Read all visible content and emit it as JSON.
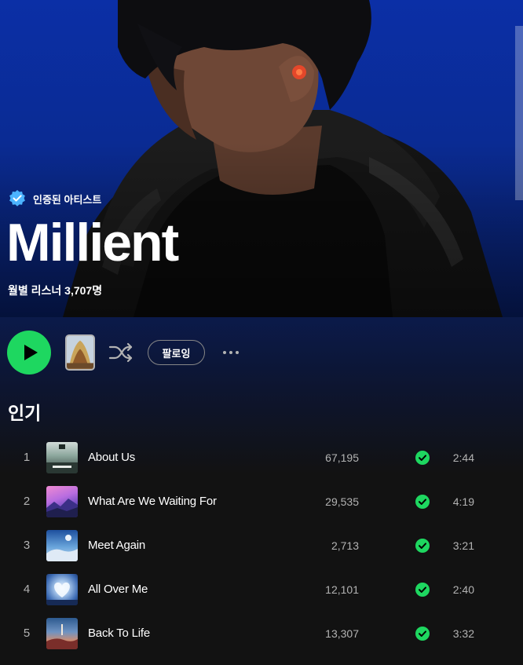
{
  "artist": {
    "verified_label": "인증된 아티스트",
    "name": "Millient",
    "monthly_listeners": "월별 리스너 3,707명"
  },
  "actions": {
    "play": "play-icon",
    "shuffle": "shuffle-icon",
    "follow_label": "팔로잉",
    "more": "more-options-icon"
  },
  "popular": {
    "title": "인기",
    "tracks": [
      {
        "number": "1",
        "title": "About Us",
        "plays": "67,195",
        "duration": "2:44"
      },
      {
        "number": "2",
        "title": "What Are We Waiting For",
        "plays": "29,535",
        "duration": "4:19"
      },
      {
        "number": "3",
        "title": "Meet Again",
        "plays": "2,713",
        "duration": "3:21"
      },
      {
        "number": "4",
        "title": "All Over Me",
        "plays": "12,101",
        "duration": "2:40"
      },
      {
        "number": "5",
        "title": "Back To Life",
        "plays": "13,307",
        "duration": "3:32"
      }
    ]
  },
  "colors": {
    "accent": "#1ed760",
    "hero_blue": "#0b2fa6",
    "background": "#121212",
    "secondary_text": "#b3b3b3"
  }
}
